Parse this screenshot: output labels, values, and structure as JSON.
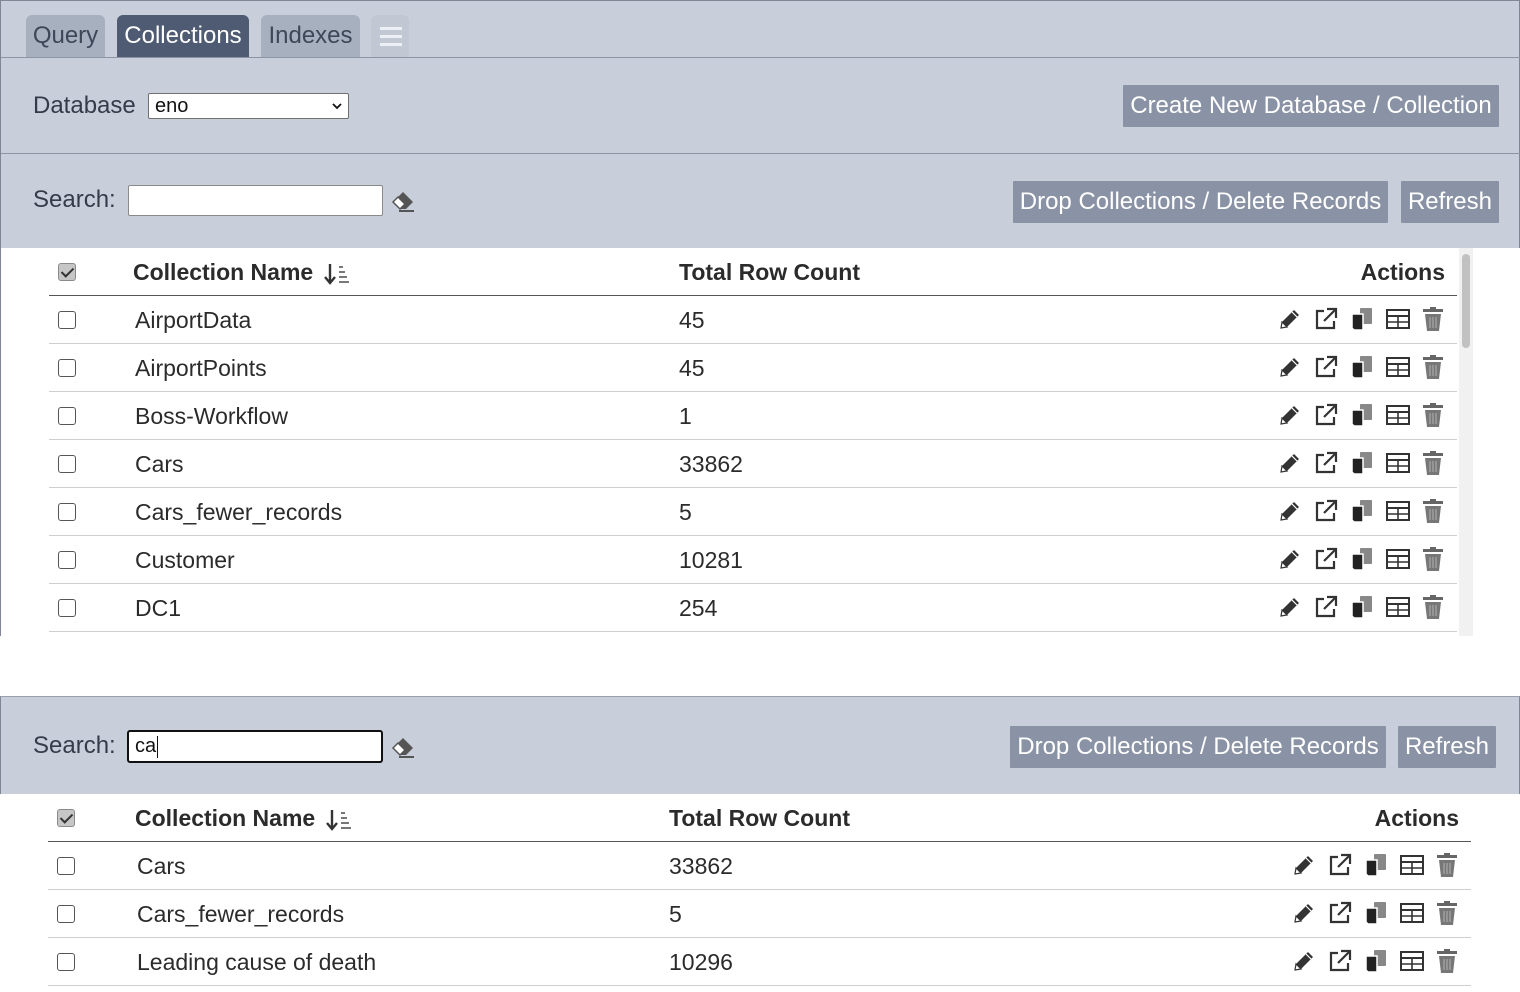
{
  "tabs": [
    {
      "label": "Query",
      "active": false
    },
    {
      "label": "Collections",
      "active": true
    },
    {
      "label": "Indexes",
      "active": false
    }
  ],
  "database": {
    "label": "Database",
    "selected": "eno",
    "create_button": "Create New Database / Collection"
  },
  "search_top": {
    "label": "Search:",
    "value": "",
    "drop_button": "Drop Collections / Delete Records",
    "refresh_button": "Refresh"
  },
  "search_bottom": {
    "label": "Search:",
    "value": "ca",
    "drop_button": "Drop Collections / Delete Records",
    "refresh_button": "Refresh"
  },
  "columns": {
    "name": "Collection Name",
    "count": "Total Row Count",
    "actions": "Actions"
  },
  "table_top": [
    {
      "name": "AirportData",
      "count": "45"
    },
    {
      "name": "AirportPoints",
      "count": "45"
    },
    {
      "name": "Boss-Workflow",
      "count": "1"
    },
    {
      "name": "Cars",
      "count": "33862"
    },
    {
      "name": "Cars_fewer_records",
      "count": "5"
    },
    {
      "name": "Customer",
      "count": "10281"
    },
    {
      "name": "DC1",
      "count": "254"
    }
  ],
  "table_bottom": [
    {
      "name": "Cars",
      "count": "33862"
    },
    {
      "name": "Cars_fewer_records",
      "count": "5"
    },
    {
      "name": "Leading cause of death",
      "count": "10296"
    }
  ],
  "icons": {
    "action_icons": [
      "pencil-icon",
      "external-link-icon",
      "copy-icon",
      "table-icon",
      "trash-icon"
    ],
    "sort": "sort-descending-icon",
    "clear": "eraser-icon",
    "menu": "list-icon"
  },
  "colors": {
    "panel": "#c8cfdb",
    "active_tab": "#4e5b73",
    "tab": "#a7b0bf",
    "button": "#8a93a5"
  }
}
